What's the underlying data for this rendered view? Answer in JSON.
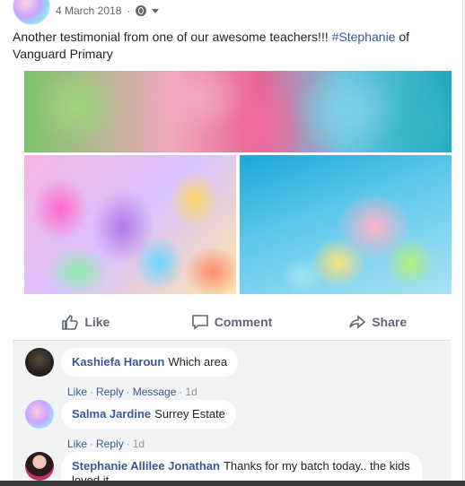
{
  "post": {
    "date": "4 March 2018",
    "text": "Another testimonial from one of our awesome teachers!!! ",
    "hashtag": "#Stephanie",
    "text_after": " of Vanguard Primary"
  },
  "actions": {
    "like": "Like",
    "comment": "Comment",
    "share": "Share"
  },
  "comments": [
    {
      "name": "Kashiefa Haroun",
      "text": "Which area",
      "like": "Like",
      "reply": "Reply",
      "message": "Message",
      "time": "1d"
    },
    {
      "name": "Salma Jardine",
      "text": "Surrey Estate",
      "like": "Like",
      "reply": "Reply",
      "time": "1d"
    },
    {
      "name": "Stephanie Allilee Jonathan",
      "text": "Thanks for my batch today.. the kids",
      "text2": "loved it"
    }
  ],
  "icons": [
    "globe-icon",
    "chevron-down-icon",
    "like-icon",
    "comment-icon",
    "share-icon"
  ],
  "colors": {
    "link": "#385898",
    "muted": "#606770",
    "comments_bg": "#f2f3f5"
  }
}
